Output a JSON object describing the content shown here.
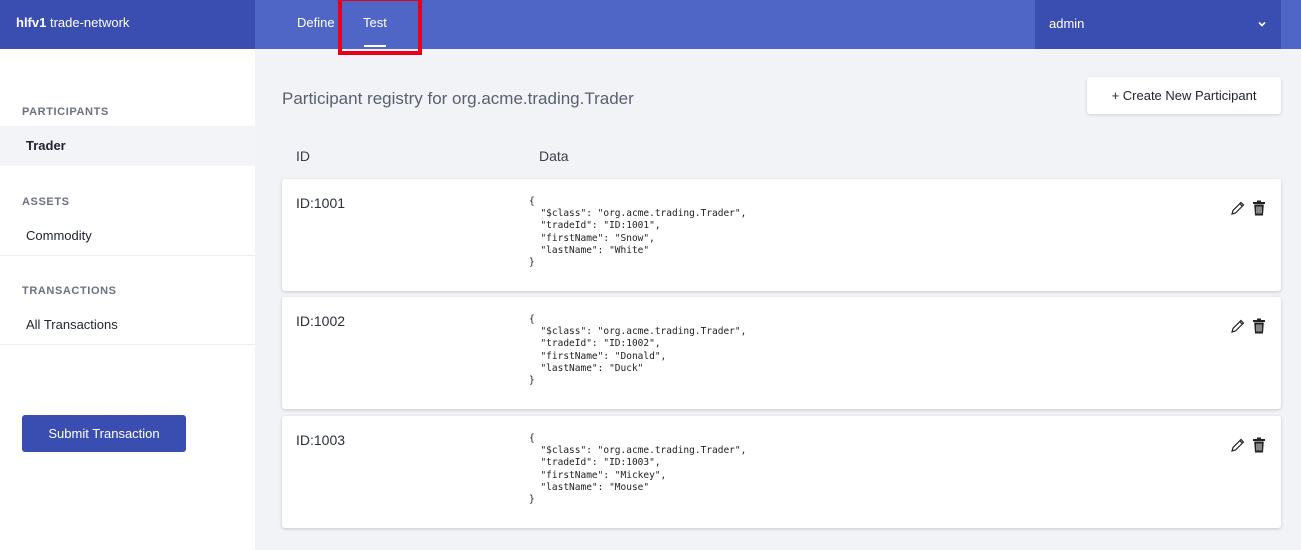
{
  "header": {
    "brand_bold": "hlfv1",
    "brand_rest": " trade-network",
    "tabs": [
      {
        "label": "Define"
      },
      {
        "label": "Test"
      }
    ],
    "user": "admin",
    "user_chevron": "chevron-down-icon"
  },
  "sidebar": {
    "sections": [
      {
        "title": "PARTICIPANTS",
        "items": [
          {
            "label": "Trader",
            "active": true
          }
        ]
      },
      {
        "title": "ASSETS",
        "items": [
          {
            "label": "Commodity"
          }
        ]
      },
      {
        "title": "TRANSACTIONS",
        "items": [
          {
            "label": "All Transactions"
          }
        ]
      }
    ],
    "submit_label": "Submit Transaction"
  },
  "main": {
    "title": "Participant registry for org.acme.trading.Trader",
    "create_label": "+ Create New Participant",
    "columns": {
      "id": "ID",
      "data": "Data"
    },
    "rows": [
      {
        "id": "ID:1001",
        "data": "{\n  \"$class\": \"org.acme.trading.Trader\",\n  \"tradeId\": \"ID:1001\",\n  \"firstName\": \"Snow\",\n  \"lastName\": \"White\"\n}"
      },
      {
        "id": "ID:1002",
        "data": "{\n  \"$class\": \"org.acme.trading.Trader\",\n  \"tradeId\": \"ID:1002\",\n  \"firstName\": \"Donald\",\n  \"lastName\": \"Duck\"\n}"
      },
      {
        "id": "ID:1003",
        "data": "{\n  \"$class\": \"org.acme.trading.Trader\",\n  \"tradeId\": \"ID:1003\",\n  \"firstName\": \"Mickey\",\n  \"lastName\": \"Mouse\"\n}"
      }
    ],
    "row_icons": [
      "pencil-icon",
      "trash-icon"
    ]
  },
  "colors": {
    "header": "#5066c7",
    "header_dark": "#3a4db0",
    "highlight": "#e8001c",
    "background": "#f2f3f7"
  }
}
